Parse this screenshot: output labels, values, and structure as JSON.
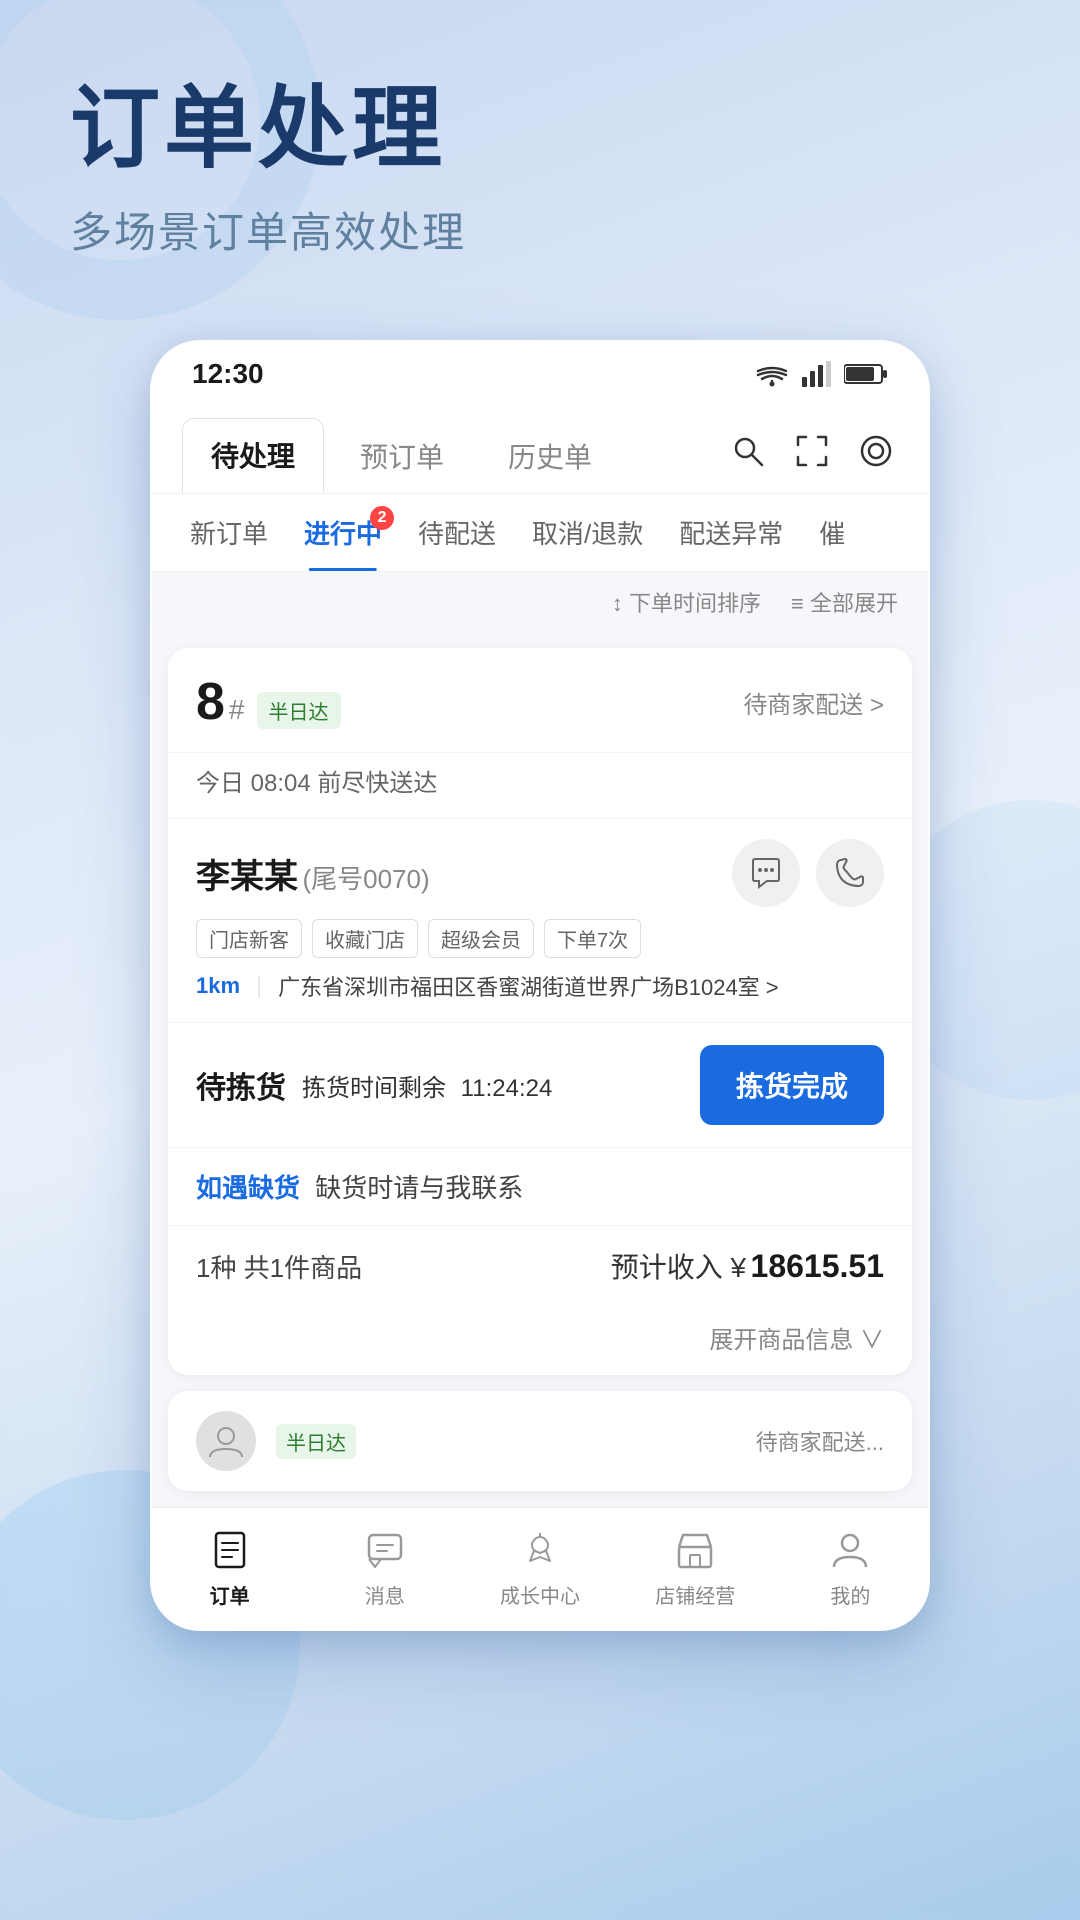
{
  "page": {
    "title": "订单处理",
    "subtitle": "多场景订单高效处理"
  },
  "status_bar": {
    "time": "12:30"
  },
  "top_nav": {
    "tabs": [
      {
        "label": "待处理",
        "active": true
      },
      {
        "label": "预订单",
        "active": false
      },
      {
        "label": "历史单",
        "active": false
      }
    ]
  },
  "sub_nav": {
    "items": [
      {
        "label": "新订单",
        "active": false,
        "badge": null
      },
      {
        "label": "进行中",
        "active": true,
        "badge": "2"
      },
      {
        "label": "待配送",
        "active": false,
        "badge": null
      },
      {
        "label": "取消/退款",
        "active": false,
        "badge": null
      },
      {
        "label": "配送异常",
        "active": false,
        "badge": null
      },
      {
        "label": "催",
        "active": false,
        "badge": null
      }
    ]
  },
  "sort_bar": {
    "time_sort": "↕ 下单时间排序",
    "expand_all": "≡ 全部展开"
  },
  "order_card": {
    "order_number": "8",
    "order_hash": "#",
    "tag": "半日达",
    "status": "待商家配送 >",
    "time_desc": "今日 08:04 前尽快送达",
    "customer": {
      "name": "李某某",
      "id_suffix": "(尾号0070)",
      "tags": [
        "门店新客",
        "收藏门店",
        "超级会员",
        "下单7次"
      ],
      "distance": "1km",
      "address": "广东省深圳市福田区香蜜湖街道世界广场B1024室 >"
    },
    "picking": {
      "label": "待拣货",
      "timer_prefix": "拣货时间剩余",
      "timer_value": "11:24:24",
      "button": "拣货完成"
    },
    "oos": {
      "link_text": "如遇缺货",
      "desc": "缺货时请与我联系"
    },
    "product": {
      "count_text": "1种 共1件商品",
      "income_prefix": "预计收入 ¥",
      "income_amount": "18615.51"
    },
    "expand_label": "展开商品信息 ∨"
  },
  "preview_card": {
    "tag": "半日达",
    "status": "待商家配送..."
  },
  "bottom_nav": {
    "items": [
      {
        "label": "订单",
        "active": true,
        "icon": "order"
      },
      {
        "label": "消息",
        "active": false,
        "icon": "message"
      },
      {
        "label": "成长中心",
        "active": false,
        "icon": "growth"
      },
      {
        "label": "店铺经营",
        "active": false,
        "icon": "store"
      },
      {
        "label": "我的",
        "active": false,
        "icon": "profile"
      }
    ]
  }
}
